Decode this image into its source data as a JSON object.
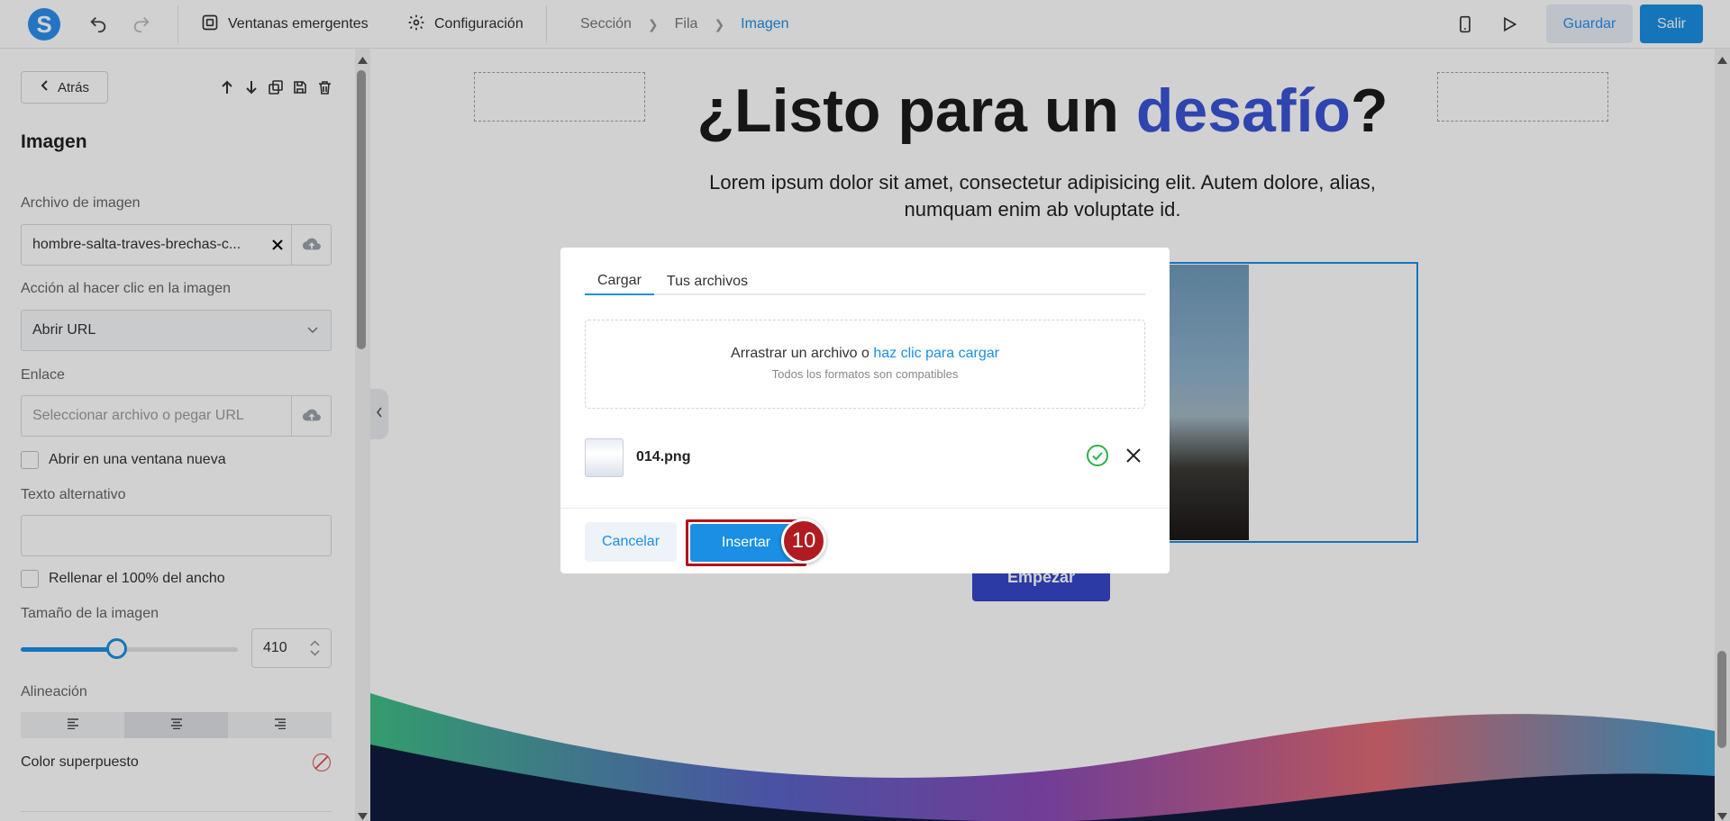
{
  "app": {
    "logo_letter": "S"
  },
  "toolbar": {
    "popups_label": "Ventanas emergentes",
    "settings_label": "Configuración",
    "save_label": "Guardar",
    "exit_label": "Salir"
  },
  "breadcrumb": [
    "Sección",
    "Fila",
    "Imagen"
  ],
  "sidebar": {
    "back_label": "Atrás",
    "section_title": "Imagen",
    "image_file_label": "Archivo de imagen",
    "image_file_value": "hombre-salta-traves-brechas-c...",
    "click_action_label": "Acción al hacer clic en la imagen",
    "click_action_value": "Abrir URL",
    "link_label": "Enlace",
    "link_placeholder": "Seleccionar archivo o pegar URL",
    "new_window_label": "Abrir en una ventana nueva",
    "new_window_checked": false,
    "alt_text_label": "Texto alternativo",
    "alt_text_value": "",
    "full_width_label": "Rellenar el 100% del ancho",
    "full_width_checked": false,
    "image_size_label": "Tamaño de la imagen",
    "image_size_value": "410",
    "image_size_fraction": 0.44,
    "alignment_label": "Alineación",
    "alignment_selected": "center",
    "overlay_color_label": "Color superpuesto"
  },
  "canvas": {
    "title_part1": "¿Listo para un ",
    "title_accent": "desafío",
    "title_part2": "?",
    "subtitle": "Lorem ipsum dolor sit amet, consectetur adipisicing elit. Autem dolore, alias, numquam enim ab voluptate id.",
    "cta_label": "Empezar",
    "accent_color": "#3a54d6"
  },
  "modal": {
    "tab_upload": "Cargar",
    "tab_files": "Tus archivos",
    "drop_text": "Arrastrar un archivo o ",
    "drop_link": "haz clic para cargar",
    "drop_hint": "Todos los formatos son compatibles",
    "file_name": "014.png",
    "cancel_label": "Cancelar",
    "insert_label": "Insertar"
  },
  "annotation": {
    "step_number": "10"
  },
  "colors": {
    "primary": "#1a8fe3",
    "highlight": "#b5121b",
    "success": "#2bb04a"
  }
}
